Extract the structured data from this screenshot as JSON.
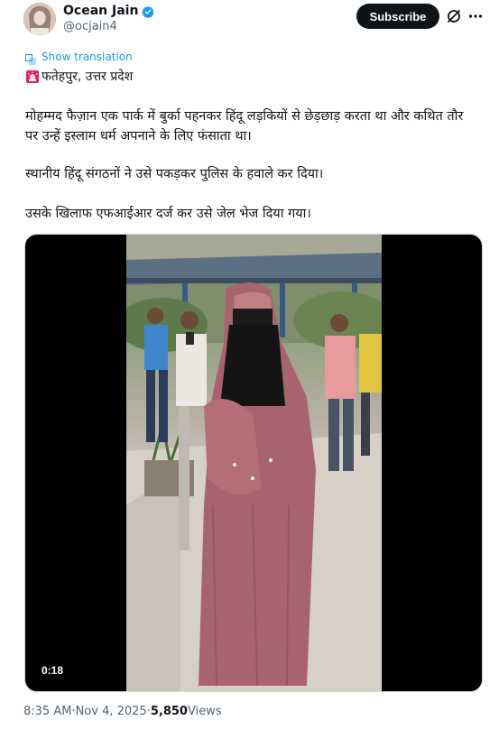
{
  "author": {
    "display_name": "Ocean Jain",
    "handle": "@ocjain4",
    "verified": true
  },
  "header": {
    "subscribe_label": "Subscribe",
    "grok_icon": "grok-slash-icon",
    "more_icon": "ellipsis-icon"
  },
  "translation": {
    "label": "Show translation"
  },
  "tweet": {
    "location_emoji": "siren-icon",
    "location": "फतेहपुर, उत्तर प्रदेश",
    "paragraph_1": "मोहम्मद फैज़ान एक पार्क में बुर्का पहनकर हिंदू लड़कियों से छेड़छाड़ करता था और कथित तौर पर उन्हें इस्लाम धर्म अपनाने के लिए फंसाता था।",
    "paragraph_2": "स्थानीय हिंदू संगठनों ने उसे पकड़कर पुलिस के हवाले कर दिया।",
    "paragraph_3": "उसके खिलाफ एफआईआर दर्ज कर उसे जेल भेज दिया गया।"
  },
  "media": {
    "duration": "0:18"
  },
  "meta": {
    "time": "8:35 AM",
    "separator_1": " · ",
    "date": "Nov 4, 2025",
    "separator_2": " · ",
    "views_count": "5,850",
    "views_label": " Views"
  },
  "colors": {
    "accent": "#1d9bf0",
    "text_primary": "#0f1419",
    "text_secondary": "#536471",
    "subscribe_bg": "#0f1419"
  }
}
